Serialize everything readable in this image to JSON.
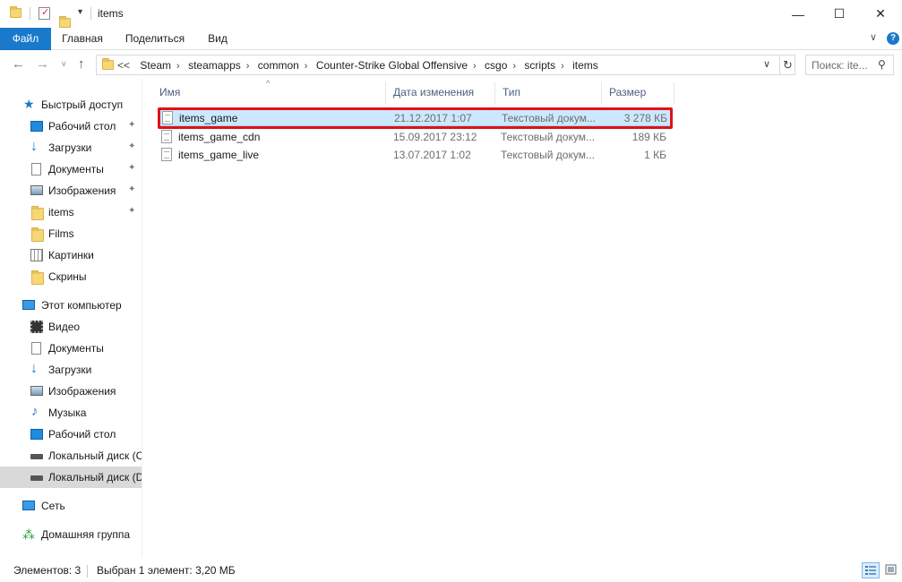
{
  "window": {
    "title": "items",
    "minimize_glyph": "—",
    "maximize_glyph": "☐",
    "close_glyph": "✕"
  },
  "ribbon": {
    "tabs": [
      {
        "label": "Файл",
        "active": true
      },
      {
        "label": "Главная"
      },
      {
        "label": "Поделиться"
      },
      {
        "label": "Вид"
      }
    ],
    "expand_glyph": "∨",
    "help_glyph": "?"
  },
  "address": {
    "overflow": "<<",
    "breadcrumbs": [
      "Steam",
      "steamapps",
      "common",
      "Counter-Strike Global Offensive",
      "csgo",
      "scripts",
      "items"
    ],
    "dropdown_glyph": "∨",
    "refresh_glyph": "↻"
  },
  "search": {
    "placeholder": "Поиск: ite..."
  },
  "sidebar": {
    "quick_access": {
      "label": "Быстрый доступ",
      "icon": "star-icon"
    },
    "quick_items": [
      {
        "label": "Рабочий стол",
        "icon": "desktop-icon",
        "pinned": true
      },
      {
        "label": "Загрузки",
        "icon": "downloads-icon",
        "pinned": true
      },
      {
        "label": "Документы",
        "icon": "documents-icon",
        "pinned": true
      },
      {
        "label": "Изображения",
        "icon": "pictures-icon",
        "pinned": true
      },
      {
        "label": "items",
        "icon": "folder-icon",
        "pinned": true
      },
      {
        "label": "Films",
        "icon": "folder-icon",
        "pinned": false
      },
      {
        "label": "Картинки",
        "icon": "pictures-grid-icon",
        "pinned": false
      },
      {
        "label": "Скрины",
        "icon": "folder-icon",
        "pinned": false
      }
    ],
    "this_pc": {
      "label": "Этот компьютер",
      "icon": "computer-icon"
    },
    "pc_items": [
      {
        "label": "Видео",
        "icon": "video-icon"
      },
      {
        "label": "Документы",
        "icon": "documents-icon"
      },
      {
        "label": "Загрузки",
        "icon": "downloads-icon"
      },
      {
        "label": "Изображения",
        "icon": "pictures-icon"
      },
      {
        "label": "Музыка",
        "icon": "music-icon"
      },
      {
        "label": "Рабочий стол",
        "icon": "desktop-icon"
      },
      {
        "label": "Локальный диск (C",
        "icon": "drive-icon"
      },
      {
        "label": "Локальный диск (D",
        "icon": "drive-icon",
        "selected": true
      }
    ],
    "network": {
      "label": "Сеть",
      "icon": "network-icon"
    },
    "homegroup": {
      "label": "Домашняя группа",
      "icon": "homegroup-icon"
    },
    "pin_glyph": "📌"
  },
  "files": {
    "sort_glyph": "^",
    "columns": [
      "Имя",
      "Дата изменения",
      "Тип",
      "Размер"
    ],
    "rows": [
      {
        "name": "items_game",
        "date": "21.12.2017 1:07",
        "type": "Текстовый докум...",
        "size": "3 278 КБ",
        "selected": true
      },
      {
        "name": "items_game_cdn",
        "date": "15.09.2017 23:12",
        "type": "Текстовый докум...",
        "size": "189 КБ"
      },
      {
        "name": "items_game_live",
        "date": "13.07.2017 1:02",
        "type": "Текстовый докум...",
        "size": "1 КБ"
      }
    ]
  },
  "status": {
    "count": "Элементов: 3",
    "selected": "Выбран 1 элемент: 3,20 МБ"
  },
  "colors": {
    "accent": "#1979ca",
    "selection_bg": "#cce8ff",
    "highlight": "#e0101a"
  }
}
